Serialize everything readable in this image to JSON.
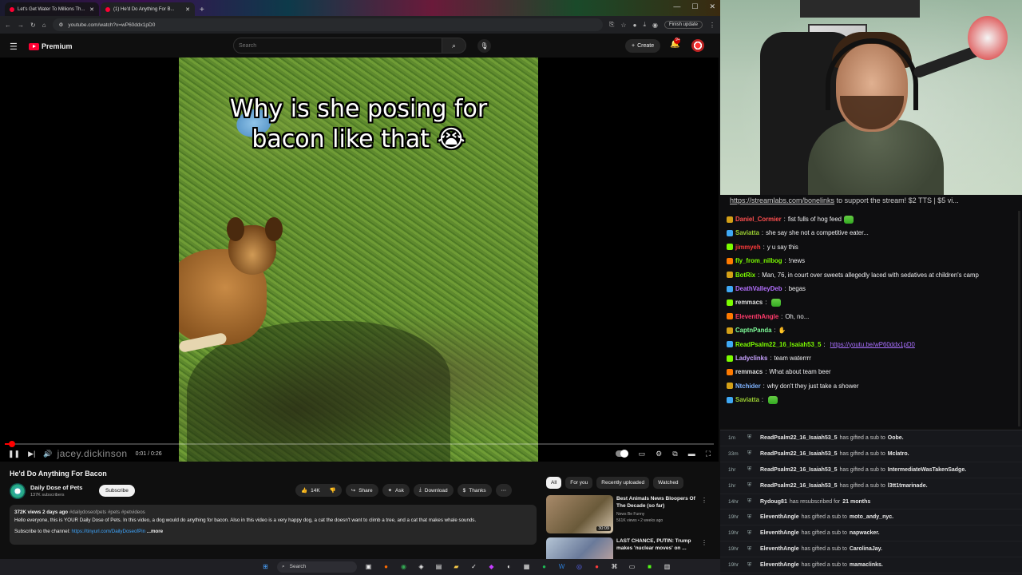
{
  "browser": {
    "tabs": [
      {
        "title": "Let's Get Water To Millions Th..."
      },
      {
        "title": "(1) He'd Do Anything For B..."
      }
    ],
    "url": "youtube.com/watch?v=wP60ddx1pD0",
    "finish_update": "Finish update"
  },
  "youtube": {
    "logo": "Premium",
    "search_placeholder": "Search",
    "create": "Create",
    "notif_count": "9+",
    "video": {
      "caption_line1": "Why is she posing for",
      "caption_line2": "bacon like that 😭",
      "watermark": "jacey.dickinson",
      "time": "0:01 / 0:26",
      "progress": 0.01
    },
    "title": "He'd Do Anything For Bacon",
    "channel": {
      "name": "Daily Dose of Pets",
      "subs": "137K subscribers",
      "subscribe": "Subscribe"
    },
    "actions": {
      "likes": "14K",
      "share": "Share",
      "ask": "Ask",
      "download": "Download",
      "thanks": "Thanks"
    },
    "description": {
      "meta": "372K views  2 days ago",
      "tags": "#dailydoseofpets #pets #petvideos",
      "body": "Hello everyone, this is YOUR Daily Dose of Pets. In this video, a dog would do anything for bacon. Also in this video is a very happy dog, a cat the doesn't want to climb a tree, and a cat that makes whale sounds.",
      "sub_prefix": "Subscribe to the channel: ",
      "sub_link": "https://tinyurl.com/DailyDoseofPin",
      "more": "...more"
    },
    "chips": [
      "All",
      "For you",
      "Recently uploaded",
      "Watched"
    ],
    "recs": [
      {
        "title": "Best Animals News Bloopers Of The Decade (so far)",
        "channel": "News Be Funny",
        "meta": "561K views • 2 weeks ago",
        "duration": "30:09"
      },
      {
        "title": "LAST CHANCE, PUTIN: Trump makes 'nuclear moves' on ...",
        "channel": "",
        "meta": "",
        "duration": ""
      }
    ]
  },
  "chat": {
    "banner_link": "https://streamlabs.com/bonelinks",
    "banner_text": " to support the stream! $2 TTS | $5 vi...",
    "messages": [
      {
        "user": "Daniel_Cormier",
        "color": "#ff4f4f",
        "text": " fist fulls of hog feed",
        "emote": true
      },
      {
        "user": "Saviatta",
        "color": "#9acd32",
        "text": " she say she not a competitive eater..."
      },
      {
        "user": "jimmyeh",
        "color": "#ff3b3b",
        "text": " y u say this"
      },
      {
        "user": "fly_from_nilbog",
        "color": "#7cfc00",
        "text": " !news"
      },
      {
        "user": "BotRix",
        "color": "#7cfc00",
        "text": " Man, 76, in court over sweets allegedly laced with sedatives at children's camp"
      },
      {
        "user": "DeathValleyDeb",
        "color": "#b470ff",
        "text": " begas"
      },
      {
        "user": "remmacs",
        "color": "#dddddd",
        "text": " ",
        "emote": true
      },
      {
        "user": "EleventhAngle",
        "color": "#ff3b6b",
        "text": " Oh, no..."
      },
      {
        "user": "CaptnPanda",
        "color": "#7fff9a",
        "text": " ✋"
      },
      {
        "user": "ReadPsalm22_16_Isaiah53_5",
        "color": "#7cfc00",
        "text": " ",
        "link": "https://youtu.be/wP60ddx1pD0"
      },
      {
        "user": "Ladyclinks",
        "color": "#c8a2ff",
        "text": " team waterrrr"
      },
      {
        "user": "remmacs",
        "color": "#dddddd",
        "text": " What about team beer"
      },
      {
        "user": "Ntchider",
        "color": "#7fb3ff",
        "text": " why don't they just take a shower"
      },
      {
        "user": "Saviatta",
        "color": "#9acd32",
        "text": " ",
        "emote": true
      }
    ]
  },
  "events": [
    {
      "time": "1m",
      "name": "ReadPsalm22_16_Isaiah53_5",
      "action": "has gifted a sub to",
      "target": "Oobe."
    },
    {
      "time": "33m",
      "name": "ReadPsalm22_16_Isaiah53_5",
      "action": "has gifted a sub to",
      "target": "Mclatro."
    },
    {
      "time": "1hr",
      "name": "ReadPsalm22_16_Isaiah53_5",
      "action": "has gifted a sub to",
      "target": "IntermediateWasTakenSadge."
    },
    {
      "time": "1hr",
      "name": "ReadPsalm22_16_Isaiah53_5",
      "action": "has gifted a sub to",
      "target": "l3tt1tmarinade."
    },
    {
      "time": "14hr",
      "name": "Rydoug81",
      "action": "has resubscribed for",
      "target": "21 months"
    },
    {
      "time": "19hr",
      "name": "EleventhAngle",
      "action": "has gifted a sub to",
      "target": "moto_andy_nyc."
    },
    {
      "time": "19hr",
      "name": "EleventhAngle",
      "action": "has gifted a sub to",
      "target": "napwacker."
    },
    {
      "time": "19hr",
      "name": "EleventhAngle",
      "action": "has gifted a sub to",
      "target": "CarolinaJay."
    },
    {
      "time": "19hr",
      "name": "EleventhAngle",
      "action": "has gifted a sub to",
      "target": "mamaclinks."
    }
  ],
  "taskbar": {
    "search": "Search"
  },
  "colors": {
    "youtube_red": "#ff0033",
    "bg": "#0f0f0f",
    "chat_bg": "#0e0e10",
    "link": "#3ea6ff"
  }
}
